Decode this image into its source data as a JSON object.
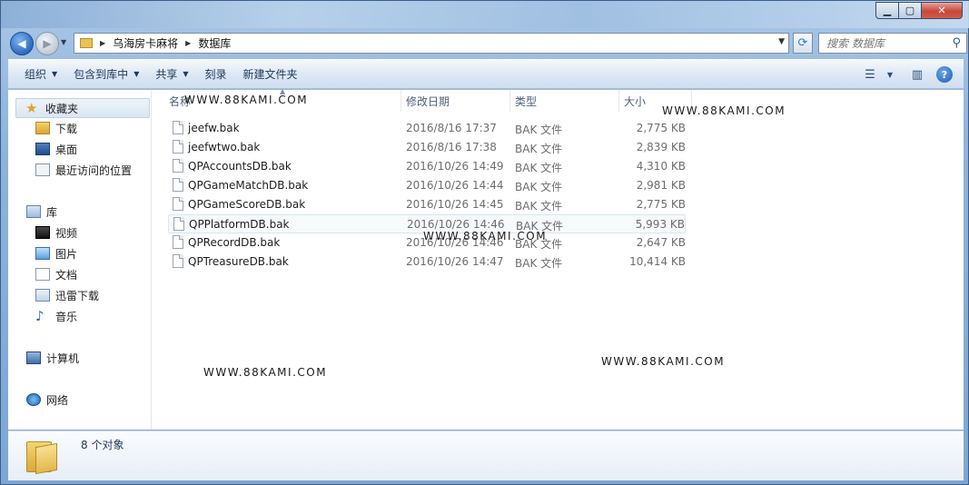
{
  "window": {
    "caption_buttons": [
      "minimize",
      "maximize",
      "close"
    ]
  },
  "address_bar": {
    "breadcrumb": [
      "乌海房卡麻将",
      "数据库"
    ]
  },
  "search": {
    "placeholder": "搜索 数据库"
  },
  "toolbar": {
    "organize": "组织",
    "include_in_library": "包含到库中",
    "share": "共享",
    "burn": "刻录",
    "new_folder": "新建文件夹"
  },
  "sidebar": {
    "favorites_label": "收藏夹",
    "favorites": [
      "下载",
      "桌面",
      "最近访问的位置"
    ],
    "libraries_label": "库",
    "libraries": [
      "视频",
      "图片",
      "文档",
      "迅雷下载",
      "音乐"
    ],
    "computer_label": "计算机",
    "network_label": "网络"
  },
  "columns": {
    "name": "名称",
    "date": "修改日期",
    "type": "类型",
    "size": "大小"
  },
  "files": [
    {
      "name": "jeefw.bak",
      "date": "2016/8/16 17:37",
      "type": "BAK 文件",
      "size": "2,775 KB"
    },
    {
      "name": "jeefwtwo.bak",
      "date": "2016/8/16 17:38",
      "type": "BAK 文件",
      "size": "2,839 KB"
    },
    {
      "name": "QPAccountsDB.bak",
      "date": "2016/10/26 14:49",
      "type": "BAK 文件",
      "size": "4,310 KB"
    },
    {
      "name": "QPGameMatchDB.bak",
      "date": "2016/10/26 14:44",
      "type": "BAK 文件",
      "size": "2,981 KB"
    },
    {
      "name": "QPGameScoreDB.bak",
      "date": "2016/10/26 14:45",
      "type": "BAK 文件",
      "size": "2,775 KB"
    },
    {
      "name": "QPPlatformDB.bak",
      "date": "2016/10/26 14:46",
      "type": "BAK 文件",
      "size": "5,993 KB"
    },
    {
      "name": "QPRecordDB.bak",
      "date": "2016/10/26 14:46",
      "type": "BAK 文件",
      "size": "2,647 KB"
    },
    {
      "name": "QPTreasureDB.bak",
      "date": "2016/10/26 14:47",
      "type": "BAK 文件",
      "size": "10,414 KB"
    }
  ],
  "watermark": "WWW.88KAMI.COM",
  "status": {
    "count_text": "8 个对象"
  }
}
